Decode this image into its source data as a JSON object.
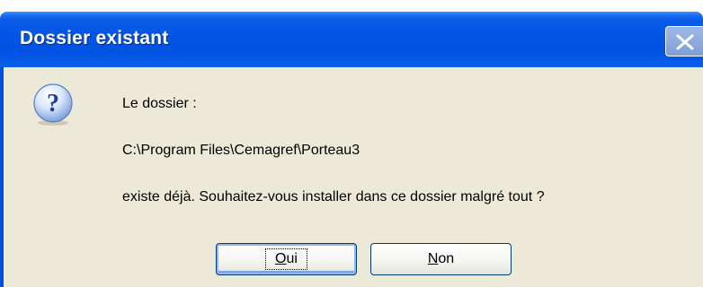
{
  "window": {
    "title": "Dossier existant"
  },
  "message": {
    "line1": "Le dossier :",
    "line2": "C:\\Program Files\\Cemagref\\Porteau3",
    "line3": "existe déjà. Souhaitez-vous installer dans ce dossier malgré tout ?"
  },
  "buttons": {
    "yes": {
      "accel": "O",
      "rest": "ui"
    },
    "no": {
      "accel": "N",
      "rest": "on"
    }
  },
  "icons": {
    "message": "question-icon",
    "close": "close-icon"
  }
}
